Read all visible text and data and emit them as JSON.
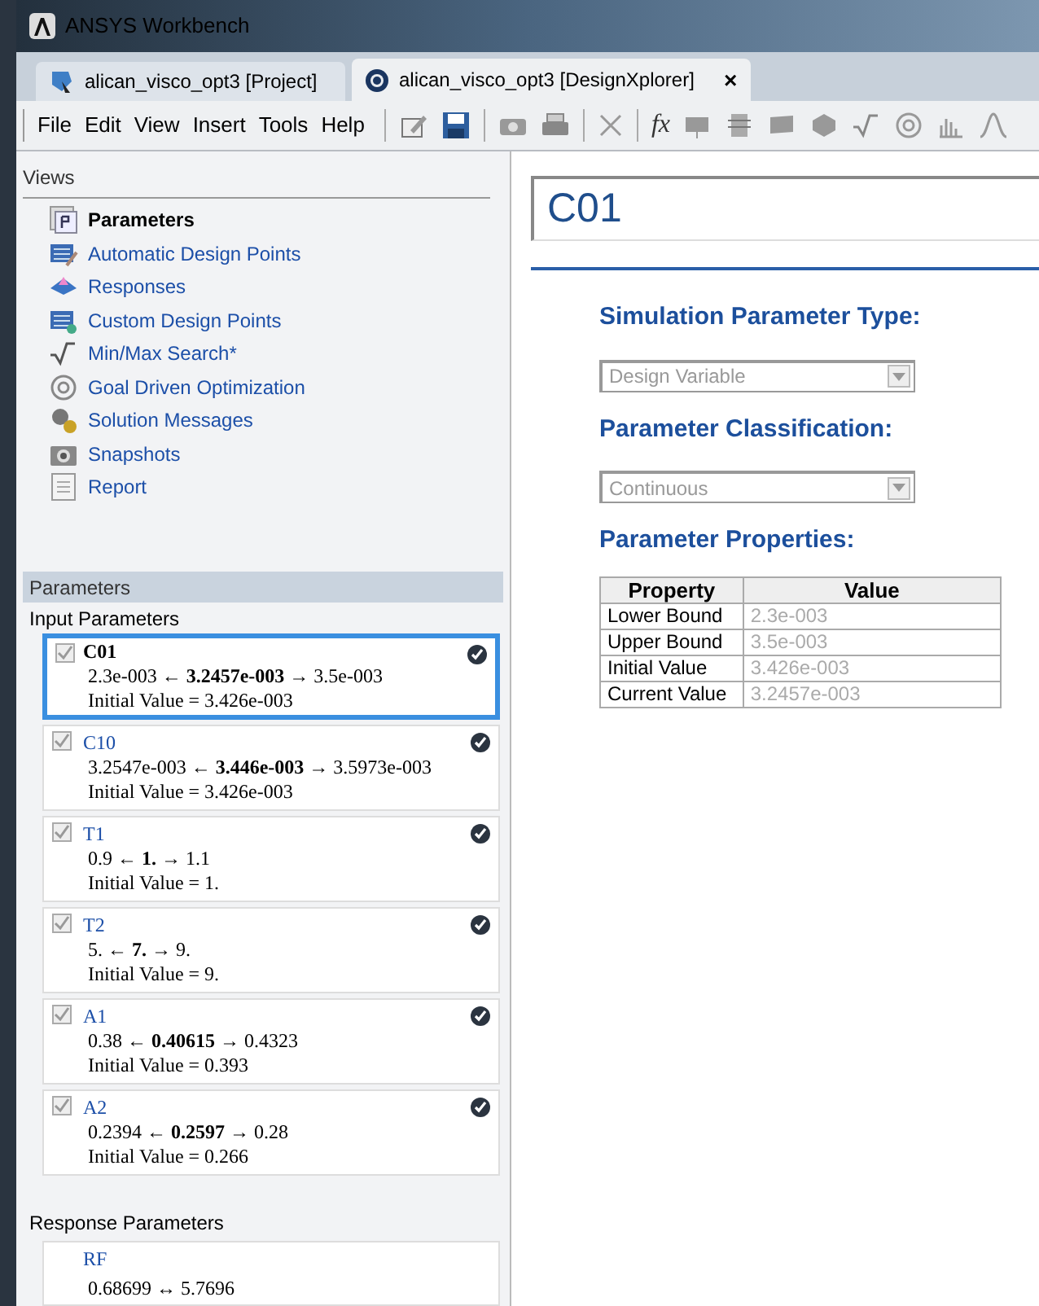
{
  "window": {
    "title": "ANSYS Workbench"
  },
  "tabs": [
    {
      "label": "alican_visco_opt3 [Project]",
      "selected": false,
      "kind": "project"
    },
    {
      "label": "alican_visco_opt3 [DesignXplorer]",
      "selected": true,
      "kind": "dx",
      "close": "×"
    }
  ],
  "menu": [
    "File",
    "Edit",
    "View",
    "Insert",
    "Tools",
    "Help"
  ],
  "toolbar": {
    "formula_button": "fx"
  },
  "views": {
    "title": "Views",
    "items": [
      {
        "label": "Parameters",
        "selected": true,
        "kind": "parameters"
      },
      {
        "label": "Automatic Design Points",
        "selected": false,
        "kind": "auto"
      },
      {
        "label": "Responses",
        "selected": false,
        "kind": "responses"
      },
      {
        "label": "Custom Design Points",
        "selected": false,
        "kind": "custom"
      },
      {
        "label": "Min/Max Search*",
        "selected": false,
        "kind": "minmax"
      },
      {
        "label": "Goal Driven Optimization",
        "selected": false,
        "kind": "goal"
      },
      {
        "label": "Solution Messages",
        "selected": false,
        "kind": "messages"
      },
      {
        "label": "Snapshots",
        "selected": false,
        "kind": "snapshots"
      },
      {
        "label": "Report",
        "selected": false,
        "kind": "report"
      }
    ]
  },
  "parameters": {
    "title": "Parameters",
    "input_title": "Input Parameters",
    "inputs": [
      {
        "name": "C01",
        "range": "2.3e-003 ← **3.2457e-003** → 3.5e-003",
        "initial": "Initial Value = 3.426e-003",
        "checked": true,
        "selected": true
      },
      {
        "name": "C10",
        "range": "3.2547e-003 ← **3.446e-003** → 3.5973e-003",
        "initial": "Initial Value = 3.426e-003",
        "checked": true,
        "selected": false
      },
      {
        "name": "T1",
        "range": "0.9 ← **1.** → 1.1",
        "initial": "Initial Value = 1.",
        "checked": true,
        "selected": false
      },
      {
        "name": "T2",
        "range": "5. ← **7.** → 9.",
        "initial": "Initial Value = 9.",
        "checked": true,
        "selected": false
      },
      {
        "name": "A1",
        "range": "0.38 ← **0.40615** → 0.4323",
        "initial": "Initial Value = 0.393",
        "checked": true,
        "selected": false
      },
      {
        "name": "A2",
        "range": "0.2394 ← **0.2597** → 0.28",
        "initial": "Initial Value = 0.266",
        "checked": true,
        "selected": false
      }
    ],
    "response_title": "Response Parameters",
    "responses": [
      {
        "name": "RF",
        "range": "0.68699 ↔ 5.7696"
      }
    ]
  },
  "detail": {
    "name": "C01",
    "type_heading": "Simulation Parameter Type:",
    "type_value": "Design Variable",
    "class_heading": "Parameter Classification:",
    "class_value": "Continuous",
    "props_heading": "Parameter Properties:",
    "columns": [
      "Property",
      "Value"
    ],
    "rows": [
      [
        "Lower Bound",
        "2.3e-003"
      ],
      [
        "Upper Bound",
        "3.5e-003"
      ],
      [
        "Initial Value",
        "3.426e-003"
      ],
      [
        "Current Value",
        "3.2457e-003"
      ]
    ]
  }
}
